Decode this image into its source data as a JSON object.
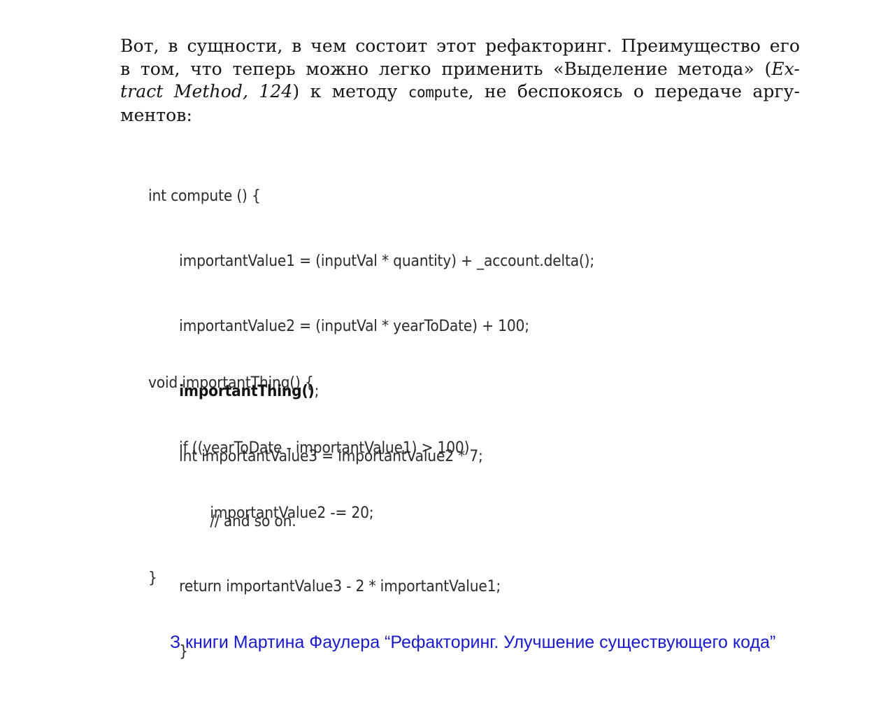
{
  "paragraph": {
    "line1": "Вот, в сущности, в чем состоит этот рефакторинг. Преимущество его",
    "line2_part1": "в том, что теперь можно легко применить «Выделение метода» (",
    "line2_italic": "Ex-",
    "line3_italic": "tract Method, 124",
    "line3_part1": ") к методу ",
    "line3_code": "compute",
    "line3_part2": ", не беспокоясь о передаче аргу-",
    "line4": "ментов:"
  },
  "code_block1": {
    "lines": [
      "int compute () {",
      "importantValue1 = (inputVal * quantity) + _account.delta();",
      "importantValue2 = (inputVal * yearToDate) + 100;",
      "importantThing()",
      ";",
      "int importantValue3 = importantValue2 * 7;",
      "// and so on.",
      "return importantValue3 - 2 * importantValue1;",
      "}"
    ]
  },
  "code_block2": {
    "lines": [
      "void importantThing() {",
      "if ((yearToDate - importantValue1) > 100)",
      "importantValue2 -= 20;",
      "}"
    ]
  },
  "caption": "З книги Мартина Фаулера “Рефакторинг. Улучшение существующего кода”"
}
